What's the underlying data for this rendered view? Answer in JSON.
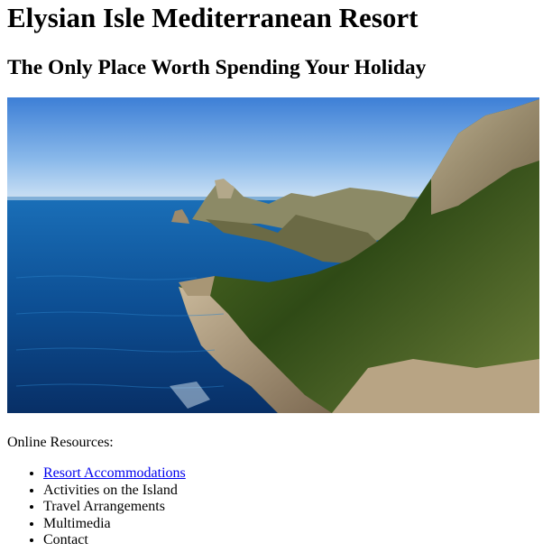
{
  "header": {
    "title": "Elysian Isle Mediterranean Resort",
    "subtitle": "The Only Place Worth Spending Your Holiday"
  },
  "hero_image": {
    "description_icon": "coastline-photo"
  },
  "resources": {
    "label": "Online Resources:",
    "items": [
      {
        "label": "Resort Accommodations",
        "is_link": true
      },
      {
        "label": "Activities on the Island",
        "is_link": false
      },
      {
        "label": "Travel Arrangements",
        "is_link": false
      },
      {
        "label": "Multimedia",
        "is_link": false
      },
      {
        "label": "Contact",
        "is_link": false
      }
    ]
  },
  "colors": {
    "link": "#0000ee",
    "text": "#000000",
    "background": "#ffffff"
  }
}
